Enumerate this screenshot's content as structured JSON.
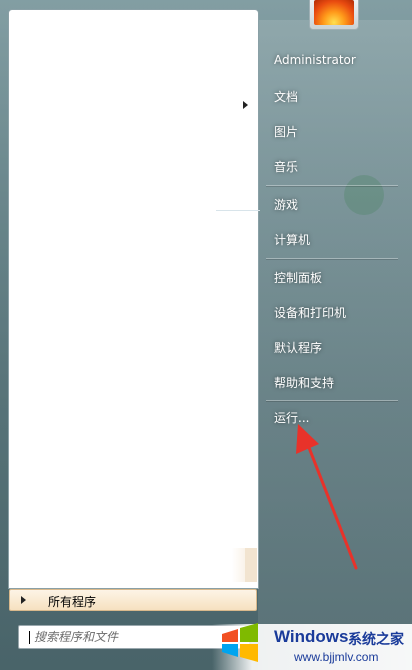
{
  "search": {
    "placeholder": "搜索程序和文件"
  },
  "all_programs": {
    "label": "所有程序"
  },
  "right_menu": {
    "user": "Administrator",
    "documents": "文档",
    "pictures": "图片",
    "music": "音乐",
    "games": "游戏",
    "computer": "计算机",
    "control_panel": "控制面板",
    "devices_printers": "设备和打印机",
    "default_programs": "默认程序",
    "help_support": "帮助和支持",
    "run": "运行..."
  },
  "watermark": {
    "brand": "Windows",
    "brand_suffix": "系统之家",
    "url": "www.bjjmlv.com"
  },
  "colors": {
    "arrow": "#e8322a",
    "brand": "#1a3b9a"
  }
}
